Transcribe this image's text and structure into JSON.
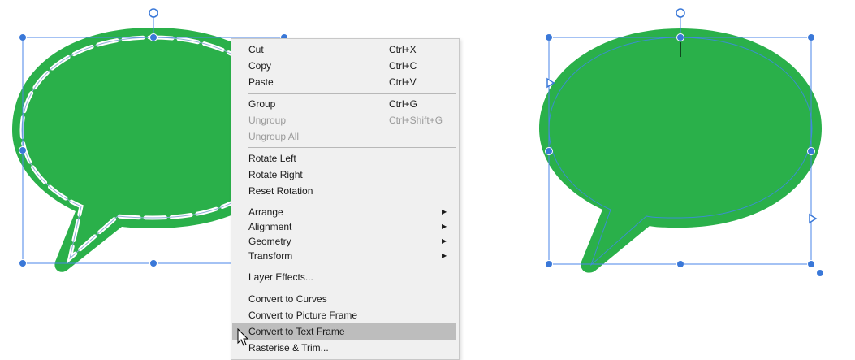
{
  "colors": {
    "bubble_fill": "#2ab04a",
    "selection": "#4a86e8",
    "handle": "#3a78d8",
    "menu_bg": "#f0f0f0",
    "menu_highlight": "#bdbdbd",
    "disabled_text": "#9a9a9a"
  },
  "context_menu": {
    "items": [
      {
        "label": "Cut",
        "shortcut": "Ctrl+X"
      },
      {
        "label": "Copy",
        "shortcut": "Ctrl+C"
      },
      {
        "label": "Paste",
        "shortcut": "Ctrl+V"
      },
      {
        "label": "Group",
        "shortcut": "Ctrl+G"
      },
      {
        "label": "Ungroup",
        "shortcut": "Ctrl+Shift+G",
        "disabled": true
      },
      {
        "label": "Ungroup All",
        "disabled": true
      },
      {
        "label": "Rotate Left"
      },
      {
        "label": "Rotate Right"
      },
      {
        "label": "Reset Rotation"
      },
      {
        "label": "Arrange",
        "submenu": true
      },
      {
        "label": "Alignment",
        "submenu": true
      },
      {
        "label": "Geometry",
        "submenu": true
      },
      {
        "label": "Transform",
        "submenu": true
      },
      {
        "label": "Layer Effects..."
      },
      {
        "label": "Convert to Curves"
      },
      {
        "label": "Convert to Picture Frame"
      },
      {
        "label": "Convert to Text Frame",
        "highlighted": true
      },
      {
        "label": "Rasterise & Trim..."
      }
    ]
  },
  "icons": {
    "submenu_arrow": "triangle-right",
    "cursor": "arrow-pointer"
  }
}
